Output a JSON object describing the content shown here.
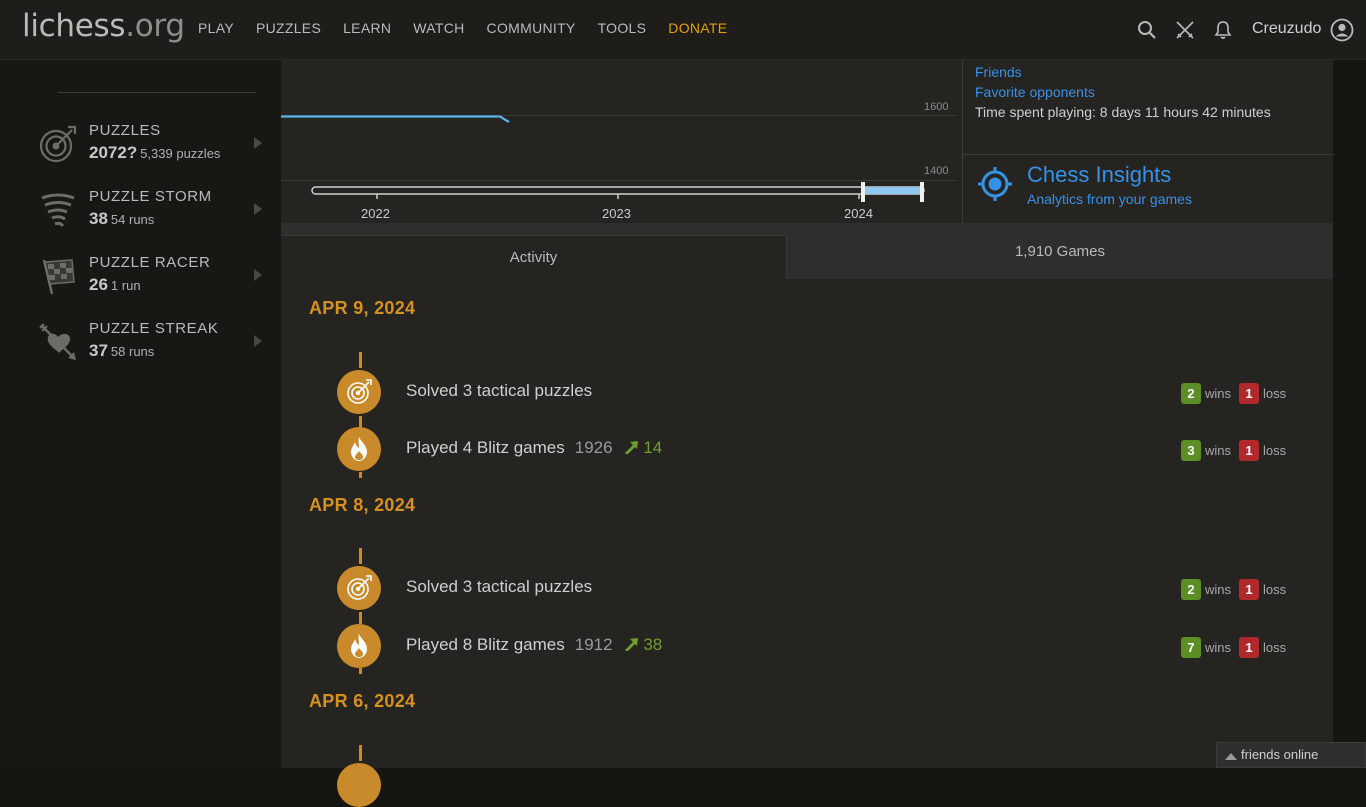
{
  "header": {
    "logo_main": "lichess",
    "logo_tld": ".org",
    "nav": [
      "PLAY",
      "PUZZLES",
      "LEARN",
      "WATCH",
      "COMMUNITY",
      "TOOLS"
    ],
    "donate": "DONATE",
    "username": "Creuzudo"
  },
  "sidebar": {
    "items": [
      {
        "name": "PUZZLES",
        "value": "2072?",
        "sub": "5,339 puzzles",
        "icon": "target-icon"
      },
      {
        "name": "PUZZLE STORM",
        "value": "38",
        "sub": "54 runs",
        "icon": "tornado-icon"
      },
      {
        "name": "PUZZLE RACER",
        "value": "26",
        "sub": "1 run",
        "icon": "checkered-flag-icon"
      },
      {
        "name": "PUZZLE STREAK",
        "value": "37",
        "sub": "58 runs",
        "icon": "arrow-heart-icon"
      }
    ]
  },
  "chart": {
    "y_labels": [
      "1600",
      "1400"
    ],
    "years": [
      "2022",
      "2023",
      "2024"
    ]
  },
  "info": {
    "friends": "Friends",
    "favorite": "Favorite opponents",
    "time_spent": "Time spent playing: 8 days 11 hours 42 minutes",
    "insights_title": "Chess Insights",
    "insights_sub": "Analytics from your games"
  },
  "tabs": {
    "activity": "Activity",
    "games": "1,910 Games"
  },
  "activity": [
    {
      "date": "APR 9, 2024",
      "entries": [
        {
          "type": "puzzle",
          "text": "Solved 3 tactical puzzles",
          "rating": "",
          "gain": "",
          "wins": "2",
          "losses": "1"
        },
        {
          "type": "blitz",
          "text": "Played 4 Blitz games",
          "rating": "1926",
          "gain": "14",
          "wins": "3",
          "losses": "1"
        }
      ]
    },
    {
      "date": "APR 8, 2024",
      "entries": [
        {
          "type": "puzzle",
          "text": "Solved 3 tactical puzzles",
          "rating": "",
          "gain": "",
          "wins": "2",
          "losses": "1"
        },
        {
          "type": "blitz",
          "text": "Played 8 Blitz games",
          "rating": "1912",
          "gain": "38",
          "wins": "7",
          "losses": "1"
        }
      ]
    },
    {
      "date": "APR 6, 2024",
      "entries": []
    }
  ],
  "labels": {
    "wins": "wins",
    "loss": "loss"
  },
  "footer": {
    "friends_online": "friends online"
  },
  "colors": {
    "accent": "#3692e7",
    "gold": "#d59120",
    "win": "#5b8e24",
    "loss": "#b2292c"
  }
}
